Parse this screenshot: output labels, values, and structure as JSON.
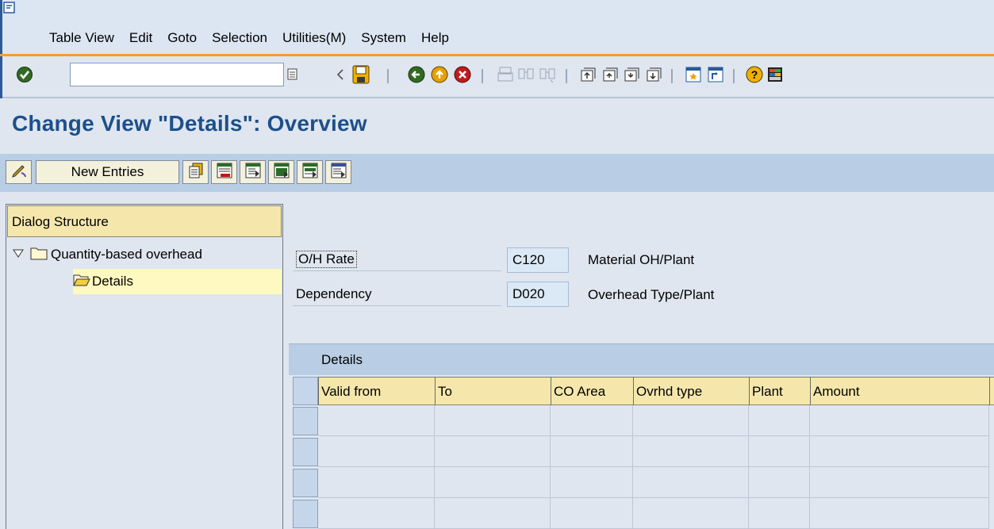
{
  "menu": {
    "items": [
      {
        "label": "Table View"
      },
      {
        "label": "Edit"
      },
      {
        "label": "Goto"
      },
      {
        "label": "Selection"
      },
      {
        "label": "Utilities(M)"
      },
      {
        "label": "System"
      },
      {
        "label": "Help"
      }
    ]
  },
  "command_field": {
    "value": ""
  },
  "title": "Change View \"Details\": Overview",
  "app_toolbar": {
    "new_entries_label": "New Entries"
  },
  "dialog_structure": {
    "header": "Dialog Structure",
    "nodes": [
      {
        "label": "Quantity-based overhead"
      },
      {
        "label": "Details"
      }
    ]
  },
  "header_fields": {
    "oh_rate": {
      "label": "O/H Rate",
      "value": "C120",
      "description": "Material OH/Plant"
    },
    "dependency": {
      "label": "Dependency",
      "value": "D020",
      "description": "Overhead Type/Plant"
    }
  },
  "table": {
    "caption": "Details",
    "columns": [
      "Valid from",
      "To",
      "CO Area",
      "Ovrhd type",
      "Plant",
      "Amount"
    ],
    "rows": [
      [
        "",
        "",
        "",
        "",
        "",
        ""
      ],
      [
        "",
        "",
        "",
        "",
        "",
        ""
      ],
      [
        "",
        "",
        "",
        "",
        "",
        ""
      ],
      [
        "",
        "",
        "",
        "",
        "",
        ""
      ]
    ]
  },
  "colors": {
    "title": "#1e4f8a",
    "accent_orange": "#f0a030",
    "header_yellow": "#f5e7ac",
    "toolbar_blue": "#b9cde4"
  }
}
